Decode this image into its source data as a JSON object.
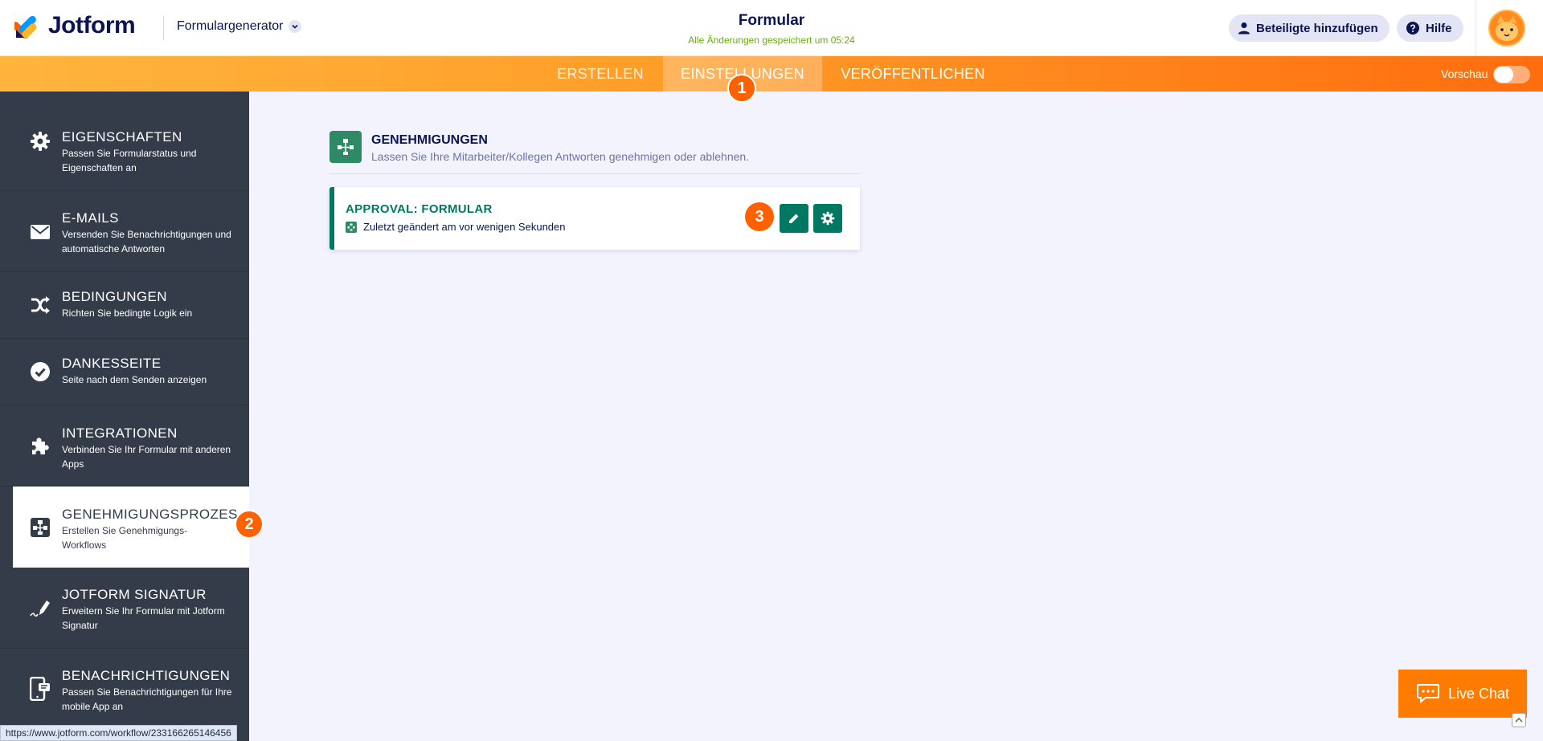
{
  "header": {
    "logo_text": "Jotform",
    "builder_label": "Formulargenerator",
    "form_title": "Formular",
    "save_status": "Alle Änderungen gespeichert um 05:24",
    "add_participants": "Beteiligte hinzufügen",
    "help": "Hilfe"
  },
  "nav": {
    "tabs": [
      {
        "label": "ERSTELLEN"
      },
      {
        "label": "EINSTELLUNGEN"
      },
      {
        "label": "VERÖFFENTLICHEN"
      }
    ],
    "preview_label": "Vorschau",
    "preview_enabled": false
  },
  "badges": [
    "1",
    "2",
    "3"
  ],
  "sidebar": {
    "items": [
      {
        "title": "EIGENSCHAFTEN",
        "desc": "Passen Sie Formularstatus und Eigenschaften an",
        "icon": "gear-icon"
      },
      {
        "title": "E-MAILS",
        "desc": "Versenden Sie Benachrichtigungen und automatische Antworten",
        "icon": "envelope-icon"
      },
      {
        "title": "BEDINGUNGEN",
        "desc": "Richten Sie bedingte Logik ein",
        "icon": "shuffle-icon"
      },
      {
        "title": "DANKESSEITE",
        "desc": "Seite nach dem Senden anzeigen",
        "icon": "check-circle-icon"
      },
      {
        "title": "INTEGRATIONEN",
        "desc": "Verbinden Sie Ihr Formular mit anderen Apps",
        "icon": "puzzle-icon"
      },
      {
        "title": "GENEHMIGUNGSPROZES...",
        "desc": "Erstellen Sie Genehmigungs-Workflows",
        "icon": "workflow-icon",
        "active": true
      },
      {
        "title": "JOTFORM SIGNATUR",
        "desc": "Erweitern Sie Ihr Formular mit Jotform Signatur",
        "icon": "signature-pen-icon"
      },
      {
        "title": "BENACHRICHTIGUNGEN",
        "desc": "Passen Sie Benachrichtigungen für Ihre mobile App an",
        "icon": "mobile-icon"
      }
    ]
  },
  "main": {
    "section_title": "GENEHMIGUNGEN",
    "section_desc": "Lassen Sie Ihre Mitarbeiter/Kollegen Antworten genehmigen oder ablehnen.",
    "approval": {
      "title": "APPROVAL: FORMULAR",
      "meta": "Zuletzt geändert am vor wenigen Sekunden"
    }
  },
  "live_chat": "Live Chat",
  "status_url": "https://www.jotform.com/workflow/233166265146456",
  "colors": {
    "accent_orange": "#ff6100",
    "approval_green": "#007862",
    "sidebar_bg": "#343c4a",
    "save_green": "#64b200"
  }
}
